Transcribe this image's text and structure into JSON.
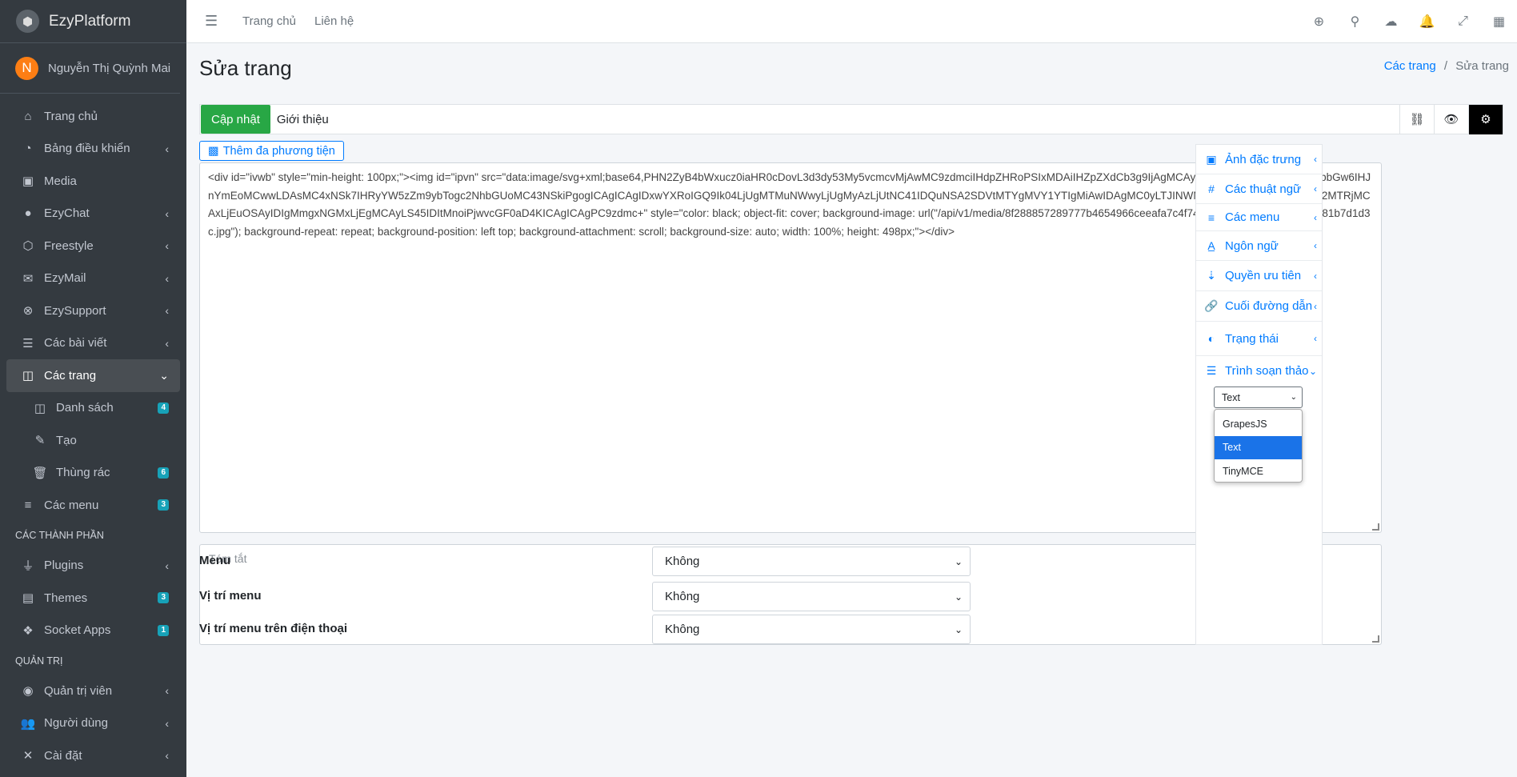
{
  "brand": {
    "name": "EzyPlatform",
    "logo_icon": "cube-icon"
  },
  "user": {
    "initial": "N",
    "name": "Nguyễn Thị Quỳnh Mai"
  },
  "sidebar": {
    "items": [
      {
        "label": "Trang chủ",
        "icon": "home-icon"
      },
      {
        "label": "Bảng điều khiển",
        "icon": "dashboard-icon"
      },
      {
        "label": "Media",
        "icon": "image-icon"
      },
      {
        "label": "EzyChat",
        "icon": "chat-icon"
      },
      {
        "label": "Freestyle",
        "icon": "cube-icon"
      },
      {
        "label": "EzyMail",
        "icon": "mail-icon"
      },
      {
        "label": "EzySupport",
        "icon": "lifebuoy-icon"
      },
      {
        "label": "Các bài viết",
        "icon": "list-icon"
      },
      {
        "label": "Các trang",
        "icon": "columns-icon"
      }
    ],
    "sub_items": [
      {
        "label": "Danh sách",
        "badge": "4"
      },
      {
        "label": "Tạo",
        "badge": ""
      },
      {
        "label": "Thùng rác",
        "badge": "6"
      }
    ],
    "menus": {
      "label": "Các menu",
      "badge": "3"
    },
    "section_components": "CÁC THÀNH PHẦN",
    "components": [
      {
        "label": "Plugins",
        "badge": ""
      },
      {
        "label": "Themes",
        "badge": "3"
      },
      {
        "label": "Socket Apps",
        "badge": "1"
      }
    ],
    "section_admin": "QUẢN TRỊ",
    "admin": [
      {
        "label": "Quản trị viên"
      },
      {
        "label": "Người dùng"
      },
      {
        "label": "Cài đặt"
      }
    ]
  },
  "topbar": {
    "home": "Trang chủ",
    "contact": "Liên hệ"
  },
  "page": {
    "title": "Sửa trang",
    "breadcrumb_parent": "Các trang",
    "breadcrumb_sep": "/",
    "breadcrumb_current": "Sửa trang"
  },
  "toolbar": {
    "update": "Cập nhật",
    "title_value": "Giới thiệu"
  },
  "media_button": "Thêm đa phương tiện",
  "editor": {
    "content": "<div id=\"ivwb\" style=\"min-height: 100px;\"><img id=\"ipvn\" src=\"data:image/svg+xml;base64,PHN2ZyB4bWxucz0iaHR0cDovL3d3dy53My5vcmcvMjAwMC9zdmciIHdpZHRoPSIxMDAiIHZpZXdCb3g9IjAgMCAyNCAyNCIgc3R5bGU9ImZpbGw6IHJnYmEoMCwwLDAsMC4xNSk7IHRyYW5zZm9ybTogc2NhbGUoMC43NSkiPgogICAgICAgIDxwYXRoIGQ9Ik04LjUgMTMuNWwyLjUgMyAzLjUtNC41IDQuNSA2SDVtMTYgMVY1YTIgMiAwIDAgMC0yLTJINWMtMS4xIDAtMiAuOS0yIDJ2MTRjMCAxLjEuOSAyIDIgMmgxNGMxLjEgMCAyLS45IDItMnoiPjwvcGF0aD4KICAgICAgPC9zdmc+\" style=\"color: black; object-fit: cover; background-image: url(\"/api/v1/media/8f288857289777b4654966ceeafa7c4f74d9b5fa4dd0221a400810081b7d1d3c.jpg\"); background-repeat: repeat; background-position: left top; background-attachment: scroll; background-size: auto; width: 100%; height: 498px;\"></div>"
  },
  "summary": {
    "placeholder": "Tóm tắt"
  },
  "side_panel": {
    "items": [
      {
        "label": "Ảnh đặc trưng",
        "icon": "image-icon"
      },
      {
        "label": "Các thuật ngữ",
        "icon": "hashtag-icon"
      },
      {
        "label": "Các menu",
        "icon": "bars-icon"
      },
      {
        "label": "Ngôn ngữ",
        "icon": "language-icon"
      },
      {
        "label": "Quyền ưu tiên",
        "icon": "sort-icon"
      },
      {
        "label": "Cuối đường dẫn",
        "icon": "link-icon"
      },
      {
        "label": "Trạng thái",
        "icon": "toggle-icon"
      },
      {
        "label": "Trình soạn thảo",
        "icon": "list-icon"
      }
    ],
    "editor_select": {
      "value": "Text",
      "options": [
        "GrapesJS",
        "Text",
        "TinyMCE"
      ]
    }
  },
  "form": [
    {
      "label": "Menu",
      "value": "Không"
    },
    {
      "label": "Vị trí menu",
      "value": "Không"
    },
    {
      "label": "Vị trí menu trên điện thoại",
      "value": "Không"
    }
  ],
  "colors": {
    "sidebar": "#343a40",
    "primary": "#007bff",
    "success": "#28a745",
    "badge": "#17a2b8",
    "avatar": "#fd7e14"
  }
}
